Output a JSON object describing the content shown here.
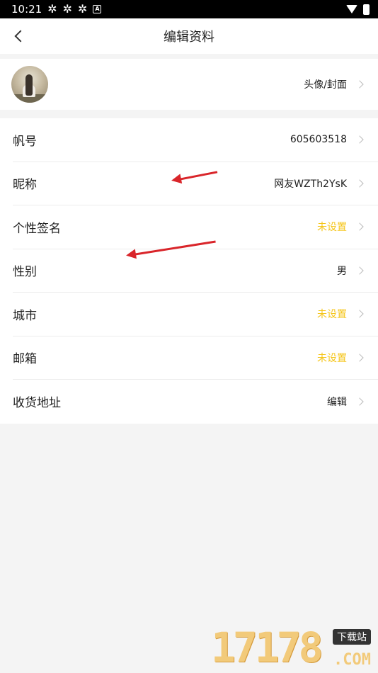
{
  "status_bar": {
    "time": "10:21",
    "icons": [
      "pinwheel-icon",
      "pinwheel-icon",
      "pinwheel-icon",
      "a-icon"
    ],
    "right_icons": [
      "wifi-icon",
      "battery-icon"
    ]
  },
  "nav": {
    "title": "编辑资料",
    "back_icon": "chevron-left-icon"
  },
  "avatar_row": {
    "label": "头像/封面"
  },
  "fields": [
    {
      "label": "帆号",
      "value": "605603518",
      "unset": false
    },
    {
      "label": "昵称",
      "value": "网友WZTh2YsK",
      "unset": false
    },
    {
      "label": "个性签名",
      "value": "未设置",
      "unset": true
    },
    {
      "label": "性别",
      "value": "男",
      "unset": false
    },
    {
      "label": "城市",
      "value": "未设置",
      "unset": true
    },
    {
      "label": "邮箱",
      "value": "未设置",
      "unset": true
    },
    {
      "label": "收货地址",
      "value": "编辑",
      "unset": false
    }
  ],
  "colors": {
    "unset_value": "#f5c518",
    "annotation_arrow": "#d9252a",
    "background": "#f4f4f4"
  },
  "watermark": {
    "number": "17178",
    "tag": "下载站",
    "suffix": ".COM"
  }
}
